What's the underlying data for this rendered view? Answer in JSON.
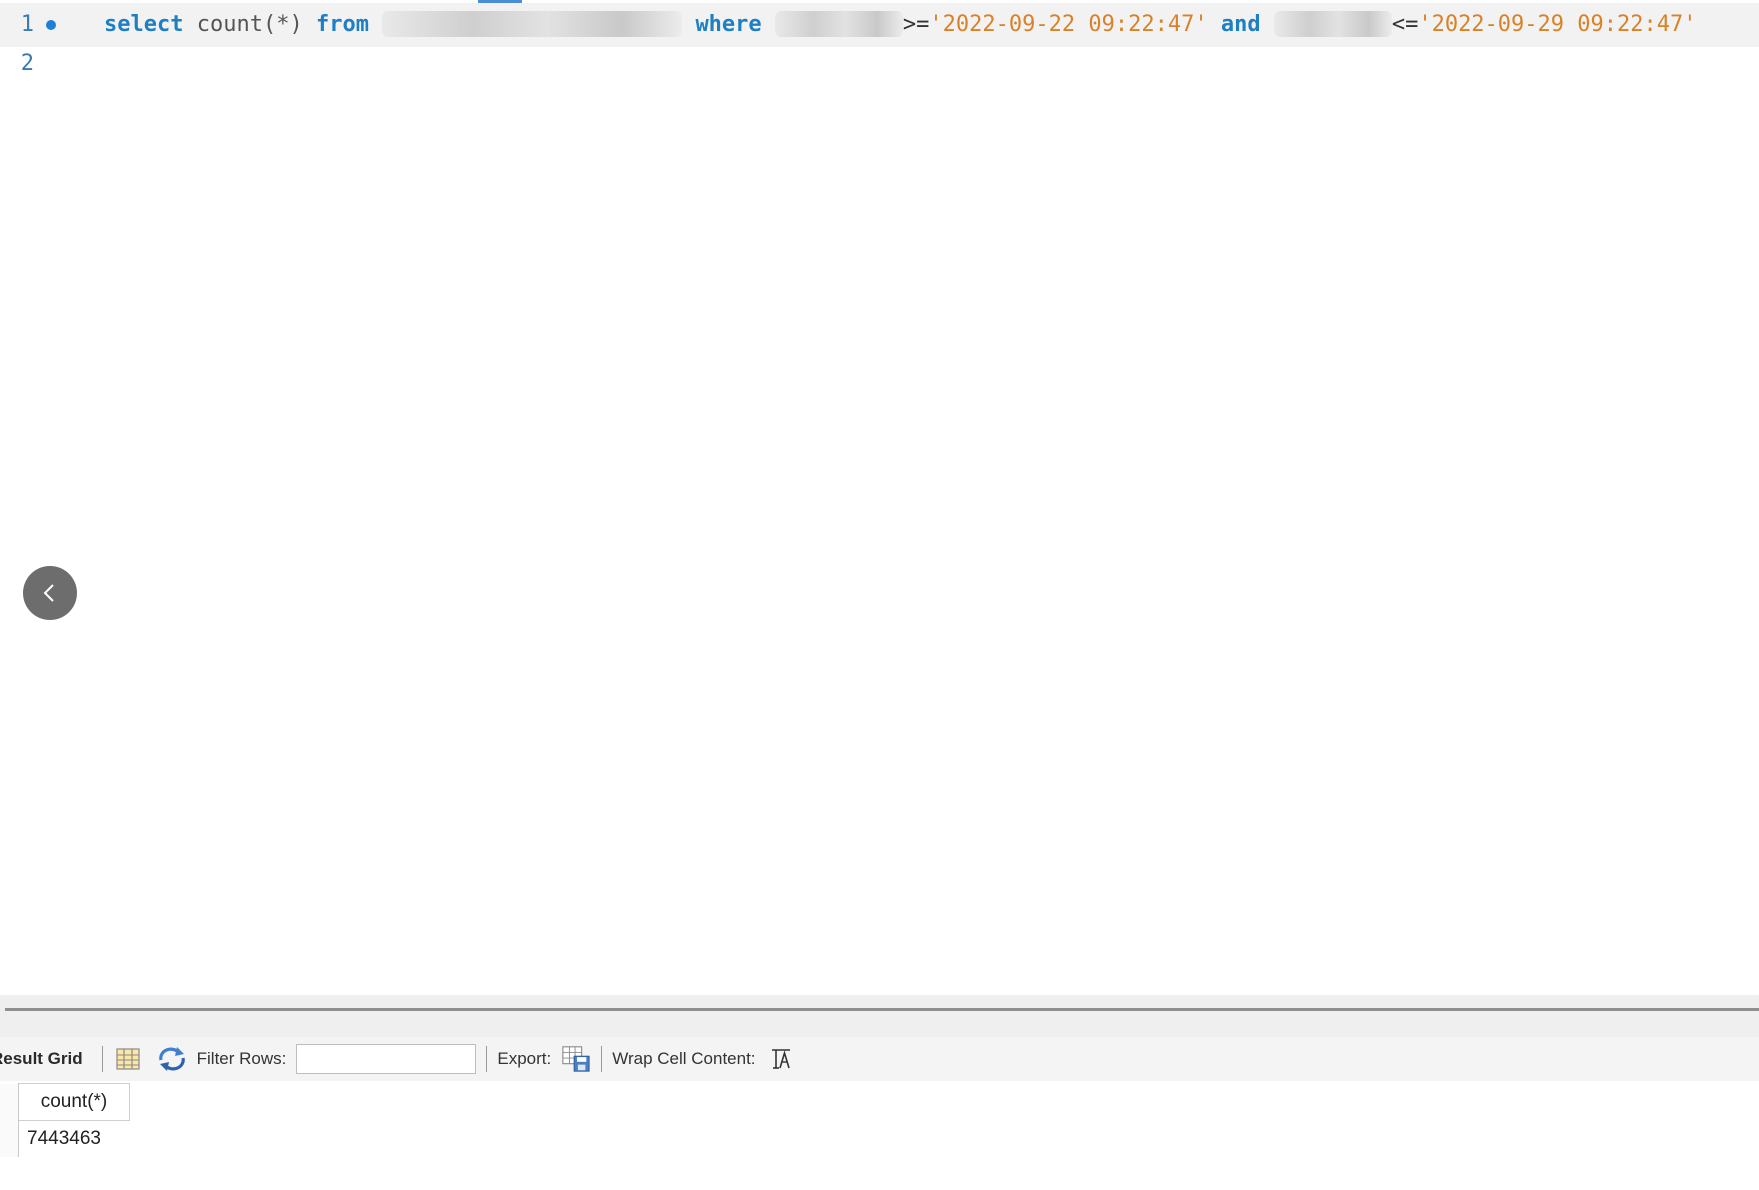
{
  "editor": {
    "lines": [
      {
        "number": "1",
        "tokens": {
          "select": "select",
          "count": "count(*)",
          "from": "from",
          "where": "where",
          "op_gte": ">=",
          "date_start": "'2022-09-22 09:22:47'",
          "and": "and",
          "op_lte": "<=",
          "date_end": "'2022-09-29 09:22:47'"
        }
      },
      {
        "number": "2"
      }
    ]
  },
  "results": {
    "tab_label": "Result Grid",
    "filter_label": "Filter Rows:",
    "filter_value": "",
    "export_label": "Export:",
    "wrap_label": "Wrap Cell Content:",
    "columns": [
      "count(*)"
    ],
    "rows": [
      [
        "7443463"
      ]
    ]
  },
  "colors": {
    "keyword": "#1e7fc4",
    "string": "#d8822a",
    "line_number": "#3a7bb0"
  }
}
